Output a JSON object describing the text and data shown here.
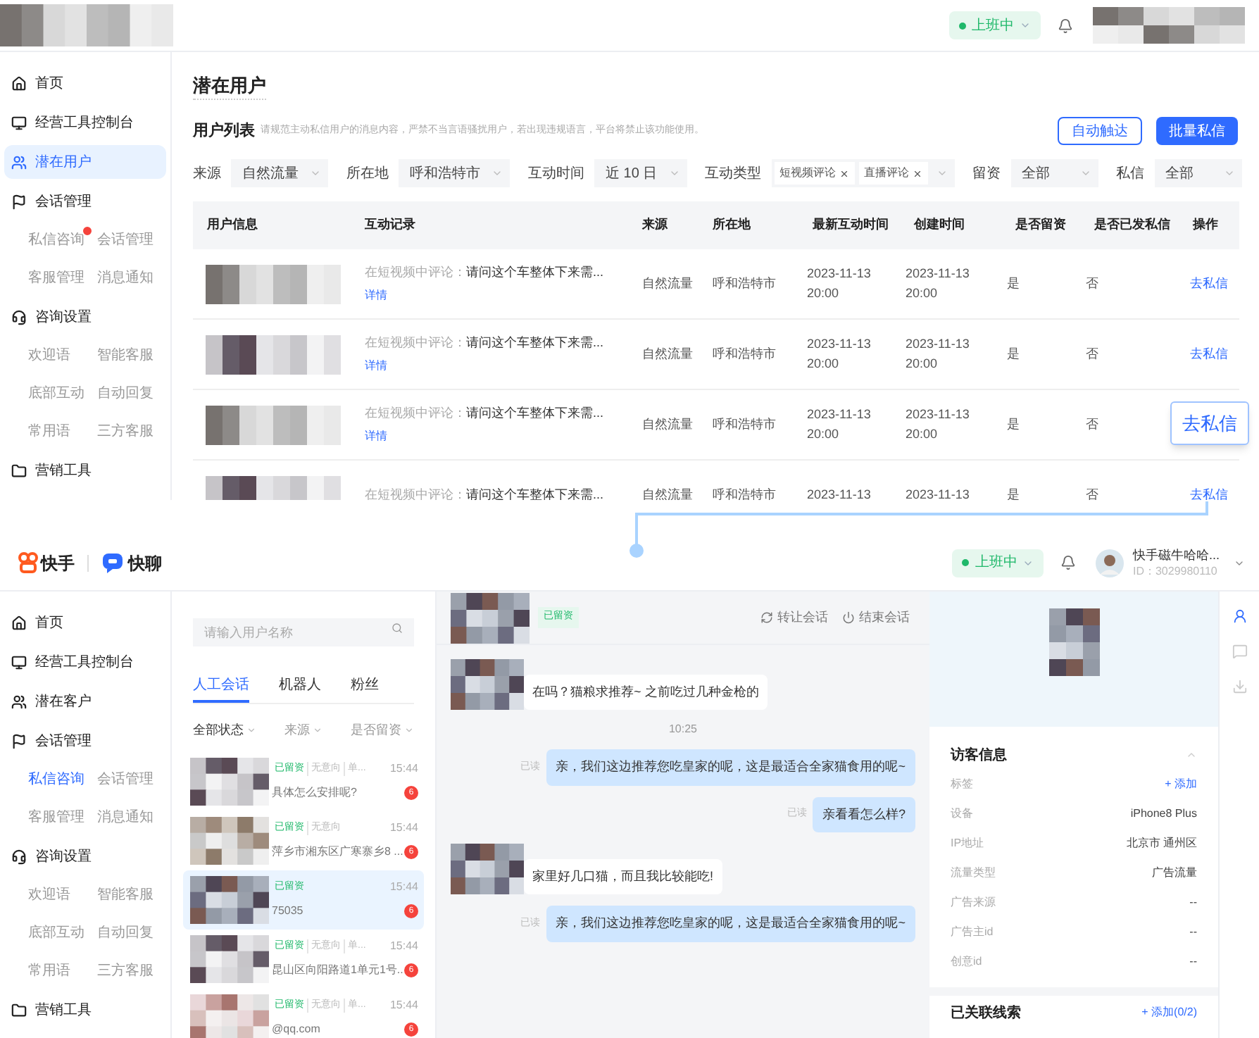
{
  "top": {
    "header": {
      "status": "上班中"
    },
    "sidebar": [
      {
        "label": "首页",
        "selected": false
      },
      {
        "label": "经营工具控制台",
        "selected": false
      },
      {
        "label": "潜在用户",
        "selected": true
      },
      {
        "label": "会话管理",
        "selected": false,
        "children": [
          {
            "label": "私信咨询",
            "badge": true,
            "selected": false
          },
          {
            "label": "会话管理",
            "badge": false,
            "selected": false
          },
          {
            "label": "客服管理",
            "badge": false,
            "selected": false
          },
          {
            "label": "消息通知",
            "badge": false,
            "selected": false
          }
        ]
      },
      {
        "label": "咨询设置",
        "selected": false,
        "children": [
          {
            "label": "欢迎语",
            "badge": false,
            "selected": false
          },
          {
            "label": "智能客服",
            "badge": false,
            "selected": false
          },
          {
            "label": "底部互动",
            "badge": false,
            "selected": false
          },
          {
            "label": "自动回复",
            "badge": false,
            "selected": false
          },
          {
            "label": "常用语",
            "badge": false,
            "selected": false
          },
          {
            "label": "三方客服",
            "badge": false,
            "selected": false
          }
        ]
      },
      {
        "label": "营销工具",
        "selected": false
      }
    ],
    "page_title": "潜在用户",
    "list_title": "用户列表",
    "notice": "请规范主动私信用户的消息内容，严禁不当言语骚扰用户，若出现违规语言，平台将禁止该功能使用。",
    "buttons": [
      {
        "label": "自动触达",
        "kind": "outline"
      },
      {
        "label": "批量私信",
        "kind": "primary"
      }
    ],
    "filters": [
      {
        "label": "来源",
        "kind": "select",
        "value": "自然流量"
      },
      {
        "label": "所在地",
        "kind": "select",
        "value": "呼和浩特市"
      },
      {
        "label": "互动时间",
        "kind": "select",
        "value": "近 10 日"
      },
      {
        "label": "互动类型",
        "kind": "tags",
        "tags": [
          "短视频评论",
          "直播评论"
        ]
      },
      {
        "label": "留资",
        "kind": "select",
        "value": "全部"
      },
      {
        "label": "私信",
        "kind": "select",
        "value": "全部"
      }
    ],
    "table": {
      "columns": [
        "用户信息",
        "互动记录",
        "来源",
        "所在地",
        "最新互动时间",
        "创建时间",
        "是否留资",
        "是否已发私信",
        "操作"
      ],
      "rows": [
        {
          "record_prefix": "在短视频中评论：",
          "record": "请问这个车整体下来需...",
          "detail": "详情",
          "source": "自然流量",
          "city": "呼和浩特市",
          "latest": [
            "2023-11-13",
            "20:00"
          ],
          "created": [
            "2023-11-13",
            "20:00"
          ],
          "lead": "是",
          "messaged": "否",
          "action": "去私信",
          "highlighted": false
        },
        {
          "record_prefix": "在短视频中评论：",
          "record": "请问这个车整体下来需...",
          "detail": "详情",
          "source": "自然流量",
          "city": "呼和浩特市",
          "latest": [
            "2023-11-13",
            "20:00"
          ],
          "created": [
            "2023-11-13",
            "20:00"
          ],
          "lead": "是",
          "messaged": "否",
          "action": "去私信",
          "highlighted": false
        },
        {
          "record_prefix": "在短视频中评论：",
          "record": "请问这个车整体下来需...",
          "detail": "详情",
          "source": "自然流量",
          "city": "呼和浩特市",
          "latest": [
            "2023-11-13",
            "20:00"
          ],
          "created": [
            "2023-11-13",
            "20:00"
          ],
          "lead": "是",
          "messaged": "否",
          "action": "去私信",
          "highlighted": true
        },
        {
          "record_prefix": "在短视频中评论：",
          "record": "请问这个车整体下来需...",
          "source": "自然流量",
          "city": "呼和浩特市",
          "latest": [
            "2023-11-13"
          ],
          "created": [
            "2023-11-13"
          ],
          "lead": "是",
          "messaged": "否",
          "action": "去私信",
          "highlighted": false
        }
      ]
    }
  },
  "bottom": {
    "logo": {
      "brand": "快手",
      "product": "快聊"
    },
    "header": {
      "status": "上班中",
      "user_name": "快手磁牛哈哈...",
      "user_id": "ID：3029980110"
    },
    "sidebar": [
      {
        "label": "首页",
        "selected": false
      },
      {
        "label": "经营工具控制台",
        "selected": false
      },
      {
        "label": "潜在客户",
        "selected": false
      },
      {
        "label": "会话管理",
        "selected": false,
        "children": [
          {
            "label": "私信咨询",
            "badge": false,
            "selected": true
          },
          {
            "label": "会话管理",
            "badge": false,
            "selected": false
          },
          {
            "label": "客服管理",
            "badge": false,
            "selected": false
          },
          {
            "label": "消息通知",
            "badge": false,
            "selected": false
          }
        ]
      },
      {
        "label": "咨询设置",
        "selected": false,
        "children": [
          {
            "label": "欢迎语",
            "badge": false,
            "selected": false
          },
          {
            "label": "智能客服",
            "badge": false,
            "selected": false
          },
          {
            "label": "底部互动",
            "badge": false,
            "selected": false
          },
          {
            "label": "自动回复",
            "badge": false,
            "selected": false
          },
          {
            "label": "常用语",
            "badge": false,
            "selected": false
          },
          {
            "label": "三方客服",
            "badge": false,
            "selected": false
          }
        ]
      },
      {
        "label": "营销工具",
        "selected": false
      }
    ],
    "search": {
      "placeholder": "请输入用户名称"
    },
    "tabs": [
      {
        "label": "人工会话",
        "selected": true
      },
      {
        "label": "机器人",
        "selected": false
      },
      {
        "label": "粉丝",
        "selected": false
      }
    ],
    "filters": [
      "全部状态",
      "来源",
      "是否留资"
    ],
    "conversations": [
      {
        "tags": [
          "已留资",
          "无意向",
          "单..."
        ],
        "time": "15:44",
        "preview": "具体怎么安排呢?",
        "badge": "6",
        "selected": false
      },
      {
        "tags": [
          "已留资",
          "无意向"
        ],
        "time": "15:44",
        "preview": "萍乡市湘东区广寒寨乡8 ...",
        "badge": "6",
        "selected": false
      },
      {
        "tags": [
          "已留资"
        ],
        "time": "15:44",
        "preview": "75035",
        "badge": "6",
        "selected": true
      },
      {
        "tags": [
          "已留资",
          "无意向",
          "单..."
        ],
        "time": "15:44",
        "preview": "昆山区向阳路道1单元1号...",
        "badge": "6",
        "selected": false
      },
      {
        "tags": [
          "已留资",
          "无意向",
          "单..."
        ],
        "time": "15:44",
        "preview": "@qq.com",
        "badge": "6",
        "selected": false
      }
    ],
    "chat": {
      "tag": "已留资",
      "actions": [
        "转让会话",
        "结束会话"
      ],
      "messages": [
        {
          "kind": "in",
          "text": "在吗？猫粮求推荐~ 之前吃过几种金枪的"
        },
        {
          "kind": "time",
          "text": "10:25"
        },
        {
          "kind": "out",
          "text": "亲，我们这边推荐您吃皇家的呢，这是最适合全家猫食用的呢~",
          "status": "已读"
        },
        {
          "kind": "out",
          "text": "亲看看怎么样?",
          "status": "已读"
        },
        {
          "kind": "in",
          "text": "家里好几口猫，而且我比较能吃!"
        },
        {
          "kind": "out",
          "text": "亲，我们这边推荐您吃皇家的呢，这是最适合全家猫食用的呢~",
          "status": "已读"
        }
      ]
    },
    "visitor": {
      "title": "访客信息",
      "fields": [
        {
          "label": "标签",
          "value": "+ 添加",
          "kind": "link"
        },
        {
          "label": "设备",
          "value": "iPhone8 Plus",
          "kind": "text"
        },
        {
          "label": "IP地址",
          "value": "北京市 通州区",
          "kind": "text"
        },
        {
          "label": "流量类型",
          "value": "广告流量",
          "kind": "text"
        },
        {
          "label": "广告来源",
          "value": "--",
          "kind": "text"
        },
        {
          "label": "广告主id",
          "value": "--",
          "kind": "text"
        },
        {
          "label": "创意id",
          "value": "--",
          "kind": "text"
        }
      ]
    },
    "leads": {
      "title": "已关联线索",
      "action": "+ 添加(0/2)"
    },
    "side_tabs": [
      {
        "selected": true
      },
      {
        "selected": false
      },
      {
        "selected": false
      }
    ]
  }
}
